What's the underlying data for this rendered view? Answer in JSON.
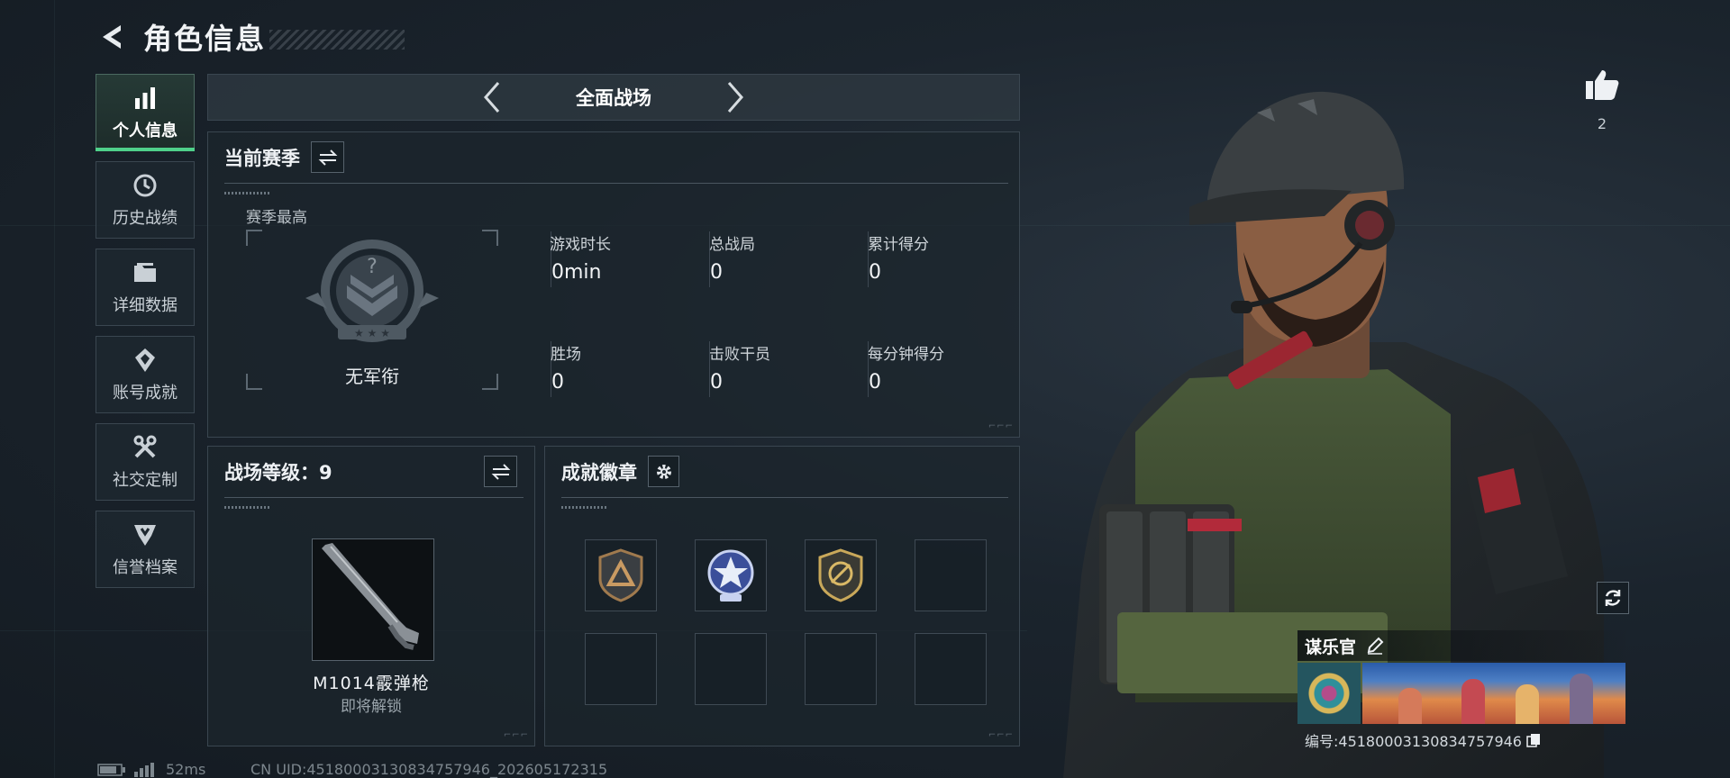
{
  "header": {
    "title": "角色信息"
  },
  "sidebar": {
    "items": [
      {
        "label": "个人信息",
        "icon": "bar-chart-icon",
        "active": true
      },
      {
        "label": "历史战绩",
        "icon": "history-icon",
        "active": false
      },
      {
        "label": "详细数据",
        "icon": "folder-icon",
        "active": false
      },
      {
        "label": "账号成就",
        "icon": "achievement-icon",
        "active": false
      },
      {
        "label": "社交定制",
        "icon": "tools-icon",
        "active": false
      },
      {
        "label": "信誉档案",
        "icon": "credit-shield-icon",
        "active": false
      }
    ]
  },
  "mode_bar": {
    "mode_name": "全面战场"
  },
  "season": {
    "title": "当前赛季",
    "best_label": "赛季最高",
    "rank_name": "无军衔",
    "stats": [
      {
        "label": "游戏时长",
        "value": "0min"
      },
      {
        "label": "总战局",
        "value": "0"
      },
      {
        "label": "累计得分",
        "value": "0"
      },
      {
        "label": "胜场",
        "value": "0"
      },
      {
        "label": "击败干员",
        "value": "0"
      },
      {
        "label": "每分钟得分",
        "value": "0"
      }
    ]
  },
  "battle_level": {
    "title": "战场等级：9",
    "weapon_name": "M1014霰弹枪",
    "weapon_status": "即将解锁"
  },
  "badges": {
    "title": "成就徽章",
    "slots": [
      "bronze-triangle-badge-icon",
      "star-emblem-badge-icon",
      "gold-crosshair-badge-icon",
      "",
      "",
      "",
      "",
      ""
    ]
  },
  "likes": {
    "count": "2"
  },
  "player": {
    "name": "谋乐官",
    "id_text": "编号:451800031308347579​46"
  },
  "status_bar": {
    "ping": "52ms",
    "uid": "CN UID:451800031308347579​46_202605172315"
  },
  "colors": {
    "accent_green": "#4fd08a",
    "panel_border": "#3a4650",
    "background": "#1b242d"
  }
}
